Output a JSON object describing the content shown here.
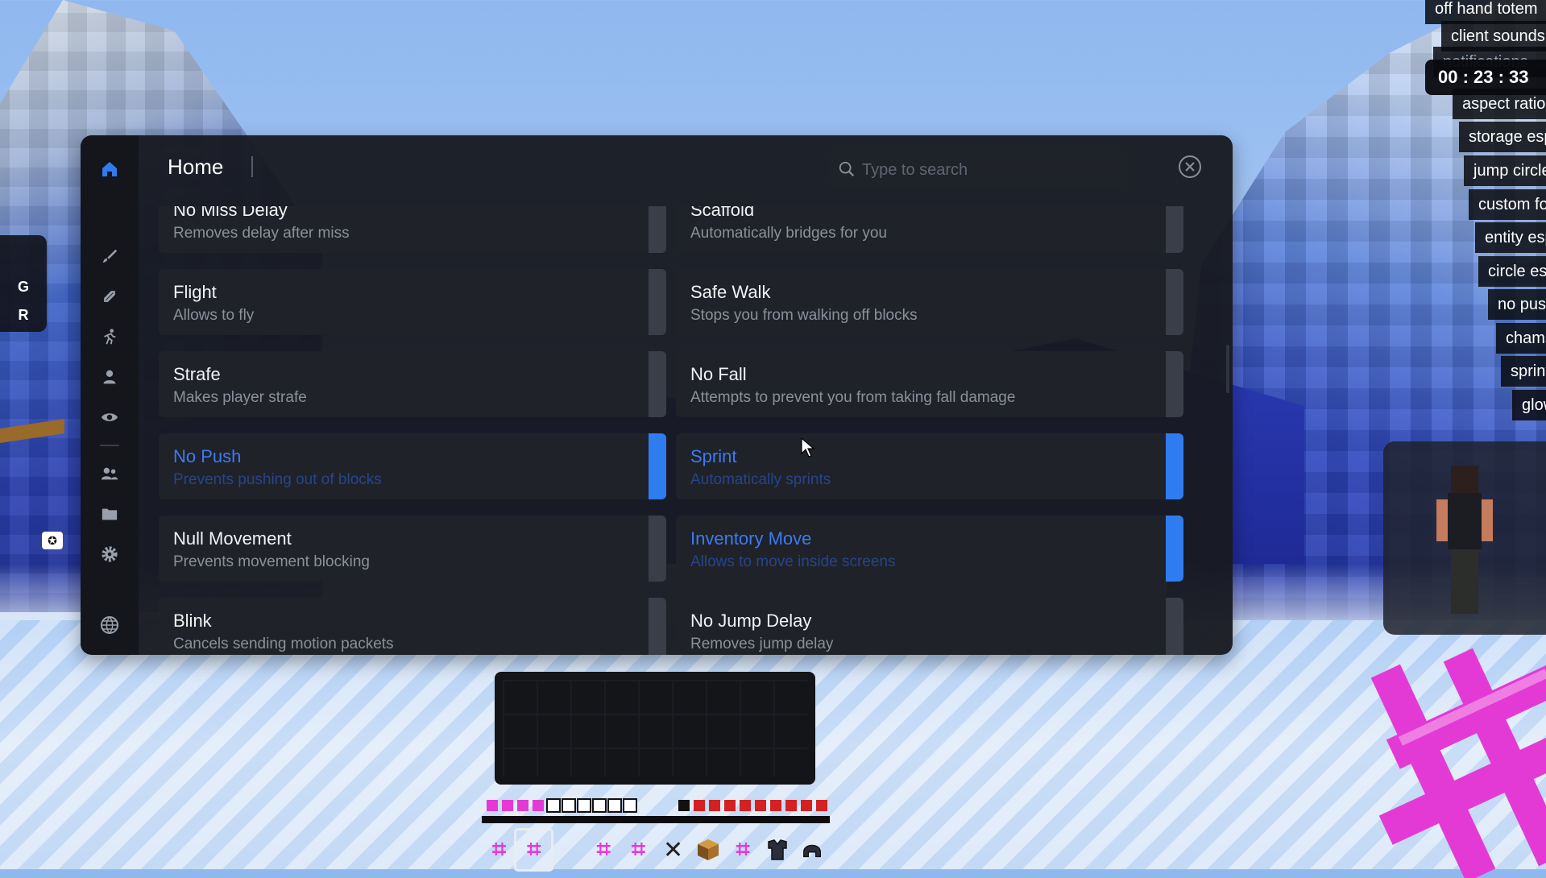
{
  "panel": {
    "title": "Home",
    "search_placeholder": "Type to search"
  },
  "modules_left": [
    {
      "name": "No Miss Delay",
      "desc": "Removes delay after miss",
      "enabled": false
    },
    {
      "name": "Flight",
      "desc": "Allows to fly",
      "enabled": false
    },
    {
      "name": "Strafe",
      "desc": "Makes player strafe",
      "enabled": false
    },
    {
      "name": "No Push",
      "desc": "Prevents pushing out of blocks",
      "enabled": true
    },
    {
      "name": "Null Movement",
      "desc": "Prevents movement blocking",
      "enabled": false
    },
    {
      "name": "Blink",
      "desc": "Cancels sending motion packets",
      "enabled": false
    }
  ],
  "modules_right": [
    {
      "name": "Scaffold",
      "desc": "Automatically bridges for you",
      "enabled": false
    },
    {
      "name": "Safe Walk",
      "desc": "Stops you from walking off blocks",
      "enabled": false
    },
    {
      "name": "No Fall",
      "desc": "Attempts to prevent you from taking fall damage",
      "enabled": false
    },
    {
      "name": "Sprint",
      "desc": "Automatically sprints",
      "enabled": true
    },
    {
      "name": "Inventory Move",
      "desc": "Allows to move inside screens",
      "enabled": true
    },
    {
      "name": "No Jump Delay",
      "desc": "Removes jump delay",
      "enabled": false
    }
  ],
  "hud": {
    "timer": "00 : 23 : 33",
    "keystrokes": [
      "G",
      "R"
    ],
    "module_list": [
      "off hand totem",
      "client sounds",
      "notifications",
      "aspect ratio",
      "storage esp",
      "jump circles",
      "custom fov",
      "entity esp",
      "circle esp",
      "no push",
      "chams",
      "sprint",
      "glow"
    ]
  },
  "colors": {
    "accent": "#2f7cf0",
    "panel_bg": "#181a21",
    "card_bg": "#1f2229"
  },
  "icons": [
    "home-icon",
    "brush-icon",
    "combat-icon",
    "movement-icon",
    "player-icon",
    "render-icon",
    "friends-icon",
    "folder-icon",
    "settings-icon",
    "globe-icon"
  ]
}
